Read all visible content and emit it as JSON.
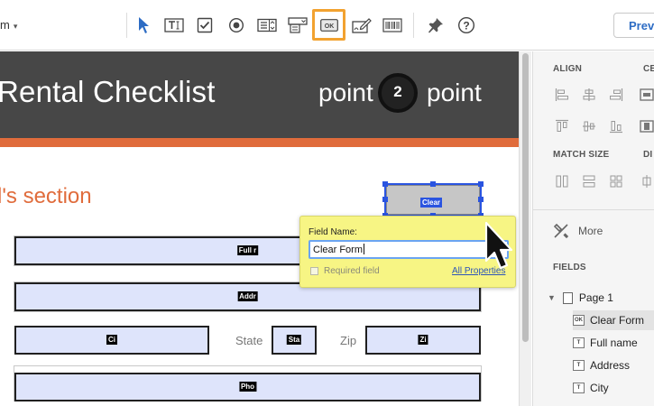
{
  "toolbar": {
    "form_menu_label": "m",
    "preview_label": "Previ",
    "tools": [
      "select-tool",
      "text-field-tool",
      "checkbox-tool",
      "radio-button-tool",
      "list-box-tool",
      "dropdown-tool",
      "button-tool",
      "signature-tool",
      "barcode-tool",
      "pin-tool",
      "help-tool"
    ],
    "ok_button_icon_text": "OK"
  },
  "document": {
    "banner_title": "Rental Checklist",
    "logo_left": "point",
    "logo_number": "2",
    "logo_right": "point",
    "section_title": "l's section",
    "fields": {
      "full_name_tag": "Full r",
      "address_tag": "Addr",
      "city_tag": "Ci",
      "state_tag": "Sta",
      "zip_tag": "Zi",
      "phone_tag": "Pho"
    },
    "labels": {
      "state": "State",
      "zip": "Zip"
    },
    "clear_button_tag": "Clear"
  },
  "popup": {
    "field_name_label": "Field Name:",
    "field_name_value": "Clear Form",
    "required_label": "Required field",
    "all_properties_label": "All Properties"
  },
  "right_panel": {
    "align_header": "ALIGN",
    "center_header": "CE",
    "match_size_header": "MATCH SIZE",
    "distribute_header": "DI",
    "more_label": "More",
    "fields_header": "FIELDS",
    "page_label": "Page 1",
    "field_items": [
      "Clear Form",
      "Full name",
      "Address",
      "City"
    ]
  },
  "colors": {
    "banner": "#474747",
    "accent_orange": "#e06c3c",
    "field_fill": "#dee4fb",
    "selection_blue": "#2a54e0",
    "popup_yellow": "#f7f584",
    "highlight_orange": "#f2a230",
    "link_blue": "#2d6cc4"
  }
}
